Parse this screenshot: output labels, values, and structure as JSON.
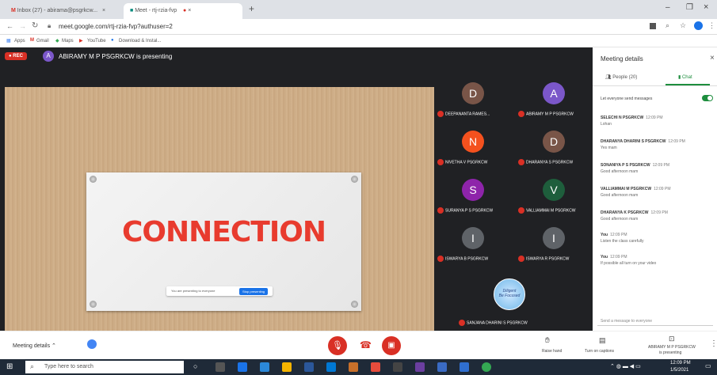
{
  "browser": {
    "tabs": [
      {
        "label": "Inbox (27) - abirama@psgrkcw...",
        "active": false
      },
      {
        "label": "Meet - rtj-rzia-fvp",
        "active": true
      }
    ],
    "new_tab": "+",
    "url": "meet.google.com/rtj-rzia-fvp?authuser=2",
    "bookmarks": [
      "Apps",
      "Gmail",
      "Maps",
      "YouTube",
      "Download & Instal..."
    ]
  },
  "meet": {
    "rec_label": "REC",
    "presenter_initial": "A",
    "presenting_text": "ABIRAMY M P PSGRKCW is presenting",
    "slide_text": "CONNECTION",
    "notice_text": "You are presenting to everyone",
    "notice_button": "Stop presenting",
    "participants": [
      {
        "initial": "D",
        "name": "DEEPANANTA RAMES...",
        "color": "#795548"
      },
      {
        "initial": "A",
        "name": "ABIRAMY M P PSGRKCW",
        "color": "#7b57c9"
      },
      {
        "initial": "N",
        "name": "NIVETHA V PSGRKCW",
        "color": "#f4511e"
      },
      {
        "initial": "D",
        "name": "DHARANYA S PSGRKCW",
        "color": "#795548"
      },
      {
        "initial": "S",
        "name": "SURANYA P S PSGRKCW",
        "color": "#8e24aa"
      },
      {
        "initial": "V",
        "name": "VALLIAMMAI M PSGRKCW",
        "color": "#1e5e3c"
      },
      {
        "initial": "I",
        "name": "ISWARYA B PSGRKCW",
        "color": "#5f6368"
      },
      {
        "initial": "I",
        "name": "ISWARYA R PSGRKCW",
        "color": "#5f6368"
      }
    ],
    "last_tile_name": "SANJANA DHARINI S PSGRKCW"
  },
  "panel": {
    "title": "Meeting details",
    "tab_people": "People (20)",
    "tab_chat": "Chat",
    "toggle_label": "Let everyone send messages",
    "messages": [
      {
        "who": "SELECHI N PSGRKCW",
        "time": "12:09 PM",
        "text": "Lohan"
      },
      {
        "who": "DHARANYA DHARINI S PSGRKCW",
        "time": "12:09 PM",
        "text": "Yes mam"
      },
      {
        "who": "SONANIYA P S PSGRKCW",
        "time": "12:09 PM",
        "text": "Good afternoon mam"
      },
      {
        "who": "VALLIAMMAI M PSGRKCW",
        "time": "12:09 PM",
        "text": "Good afternoon mam"
      },
      {
        "who": "DHARANYA K PSGRKCW",
        "time": "12:09 PM",
        "text": "Good afternoon mam"
      },
      {
        "who": "You",
        "time": "12:09 PM",
        "text": "Listen the class carefully"
      },
      {
        "who": "You",
        "time": "12:09 PM",
        "text": "If possible all turn on your video"
      }
    ],
    "input_placeholder": "Send a message to everyone"
  },
  "bottom": {
    "meeting_details": "Meeting details",
    "raise_hand": "Raise hand",
    "captions": "Turn on captions",
    "presenting_name": "ABIRAMY M P PSGRKCW",
    "presenting_sub": "is presenting"
  },
  "taskbar": {
    "search_placeholder": "Type here to search",
    "time": "12:09 PM",
    "date": "1/5/2021"
  },
  "colors": {
    "accent": "#1a73e8",
    "danger": "#d93025",
    "chat_green": "#1e8e3e"
  }
}
